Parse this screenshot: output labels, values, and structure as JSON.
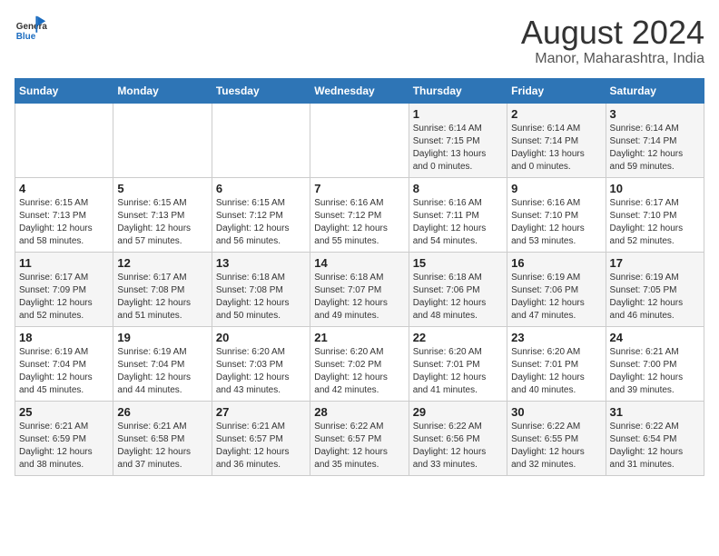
{
  "header": {
    "logo_line1": "General",
    "logo_line2": "Blue",
    "title": "August 2024",
    "subtitle": "Manor, Maharashtra, India"
  },
  "days_of_week": [
    "Sunday",
    "Monday",
    "Tuesday",
    "Wednesday",
    "Thursday",
    "Friday",
    "Saturday"
  ],
  "weeks": [
    [
      {
        "day": "",
        "content": ""
      },
      {
        "day": "",
        "content": ""
      },
      {
        "day": "",
        "content": ""
      },
      {
        "day": "",
        "content": ""
      },
      {
        "day": "1",
        "content": "Sunrise: 6:14 AM\nSunset: 7:15 PM\nDaylight: 13 hours\nand 0 minutes."
      },
      {
        "day": "2",
        "content": "Sunrise: 6:14 AM\nSunset: 7:14 PM\nDaylight: 13 hours\nand 0 minutes."
      },
      {
        "day": "3",
        "content": "Sunrise: 6:14 AM\nSunset: 7:14 PM\nDaylight: 12 hours\nand 59 minutes."
      }
    ],
    [
      {
        "day": "4",
        "content": "Sunrise: 6:15 AM\nSunset: 7:13 PM\nDaylight: 12 hours\nand 58 minutes."
      },
      {
        "day": "5",
        "content": "Sunrise: 6:15 AM\nSunset: 7:13 PM\nDaylight: 12 hours\nand 57 minutes."
      },
      {
        "day": "6",
        "content": "Sunrise: 6:15 AM\nSunset: 7:12 PM\nDaylight: 12 hours\nand 56 minutes."
      },
      {
        "day": "7",
        "content": "Sunrise: 6:16 AM\nSunset: 7:12 PM\nDaylight: 12 hours\nand 55 minutes."
      },
      {
        "day": "8",
        "content": "Sunrise: 6:16 AM\nSunset: 7:11 PM\nDaylight: 12 hours\nand 54 minutes."
      },
      {
        "day": "9",
        "content": "Sunrise: 6:16 AM\nSunset: 7:10 PM\nDaylight: 12 hours\nand 53 minutes."
      },
      {
        "day": "10",
        "content": "Sunrise: 6:17 AM\nSunset: 7:10 PM\nDaylight: 12 hours\nand 52 minutes."
      }
    ],
    [
      {
        "day": "11",
        "content": "Sunrise: 6:17 AM\nSunset: 7:09 PM\nDaylight: 12 hours\nand 52 minutes."
      },
      {
        "day": "12",
        "content": "Sunrise: 6:17 AM\nSunset: 7:08 PM\nDaylight: 12 hours\nand 51 minutes."
      },
      {
        "day": "13",
        "content": "Sunrise: 6:18 AM\nSunset: 7:08 PM\nDaylight: 12 hours\nand 50 minutes."
      },
      {
        "day": "14",
        "content": "Sunrise: 6:18 AM\nSunset: 7:07 PM\nDaylight: 12 hours\nand 49 minutes."
      },
      {
        "day": "15",
        "content": "Sunrise: 6:18 AM\nSunset: 7:06 PM\nDaylight: 12 hours\nand 48 minutes."
      },
      {
        "day": "16",
        "content": "Sunrise: 6:19 AM\nSunset: 7:06 PM\nDaylight: 12 hours\nand 47 minutes."
      },
      {
        "day": "17",
        "content": "Sunrise: 6:19 AM\nSunset: 7:05 PM\nDaylight: 12 hours\nand 46 minutes."
      }
    ],
    [
      {
        "day": "18",
        "content": "Sunrise: 6:19 AM\nSunset: 7:04 PM\nDaylight: 12 hours\nand 45 minutes."
      },
      {
        "day": "19",
        "content": "Sunrise: 6:19 AM\nSunset: 7:04 PM\nDaylight: 12 hours\nand 44 minutes."
      },
      {
        "day": "20",
        "content": "Sunrise: 6:20 AM\nSunset: 7:03 PM\nDaylight: 12 hours\nand 43 minutes."
      },
      {
        "day": "21",
        "content": "Sunrise: 6:20 AM\nSunset: 7:02 PM\nDaylight: 12 hours\nand 42 minutes."
      },
      {
        "day": "22",
        "content": "Sunrise: 6:20 AM\nSunset: 7:01 PM\nDaylight: 12 hours\nand 41 minutes."
      },
      {
        "day": "23",
        "content": "Sunrise: 6:20 AM\nSunset: 7:01 PM\nDaylight: 12 hours\nand 40 minutes."
      },
      {
        "day": "24",
        "content": "Sunrise: 6:21 AM\nSunset: 7:00 PM\nDaylight: 12 hours\nand 39 minutes."
      }
    ],
    [
      {
        "day": "25",
        "content": "Sunrise: 6:21 AM\nSunset: 6:59 PM\nDaylight: 12 hours\nand 38 minutes."
      },
      {
        "day": "26",
        "content": "Sunrise: 6:21 AM\nSunset: 6:58 PM\nDaylight: 12 hours\nand 37 minutes."
      },
      {
        "day": "27",
        "content": "Sunrise: 6:21 AM\nSunset: 6:57 PM\nDaylight: 12 hours\nand 36 minutes."
      },
      {
        "day": "28",
        "content": "Sunrise: 6:22 AM\nSunset: 6:57 PM\nDaylight: 12 hours\nand 35 minutes."
      },
      {
        "day": "29",
        "content": "Sunrise: 6:22 AM\nSunset: 6:56 PM\nDaylight: 12 hours\nand 33 minutes."
      },
      {
        "day": "30",
        "content": "Sunrise: 6:22 AM\nSunset: 6:55 PM\nDaylight: 12 hours\nand 32 minutes."
      },
      {
        "day": "31",
        "content": "Sunrise: 6:22 AM\nSunset: 6:54 PM\nDaylight: 12 hours\nand 31 minutes."
      }
    ]
  ]
}
